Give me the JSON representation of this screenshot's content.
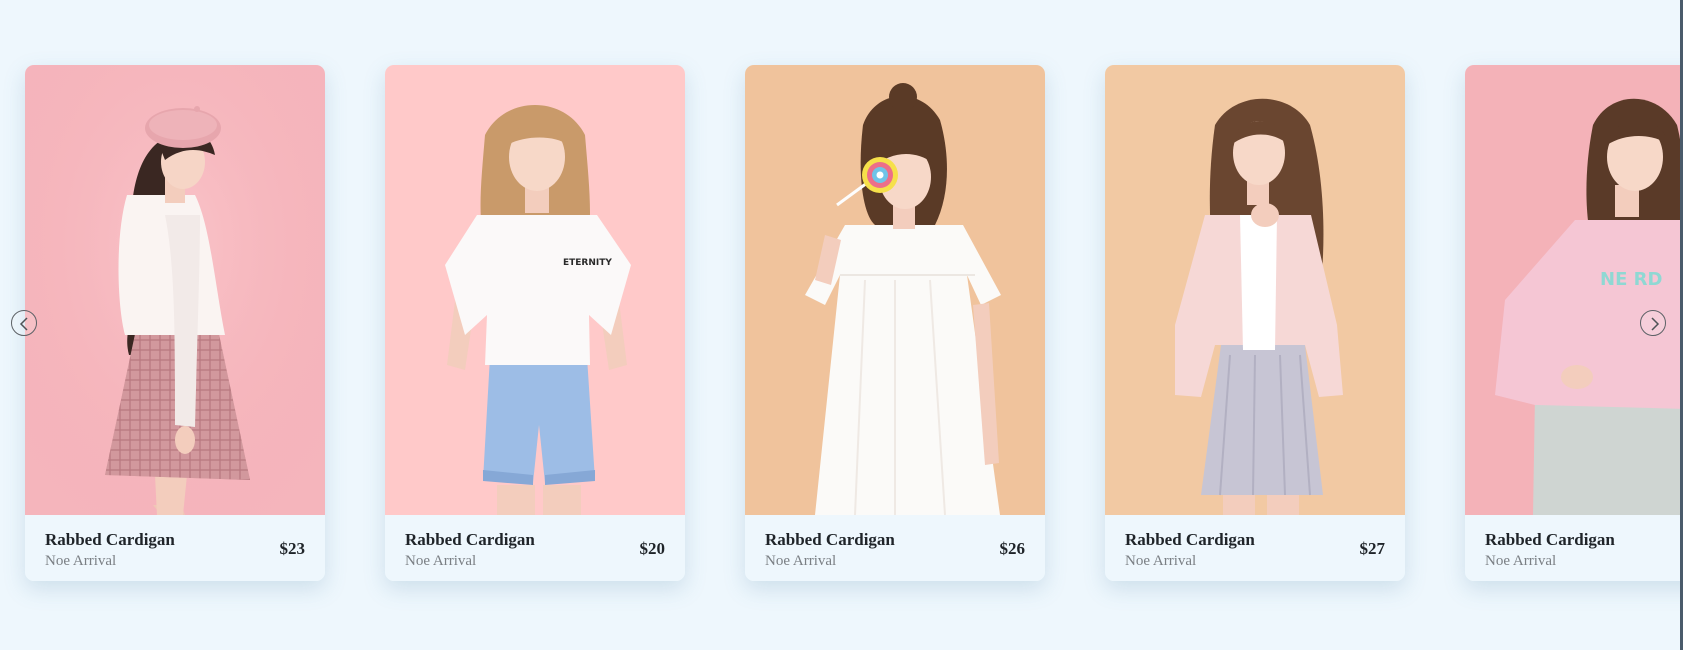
{
  "carousel": {
    "items": [
      {
        "title": "Rabbed Cardigan",
        "subtitle": "Noe Arrival",
        "price": "$23",
        "image_bg": "#f5b5bc",
        "image": "model-beret-plaid-skirt"
      },
      {
        "title": "Rabbed Cardigan",
        "subtitle": "Noe Arrival",
        "price": "$20",
        "image_bg": "#ffc9c9",
        "image": "model-white-tee-denim-shorts"
      },
      {
        "title": "Rabbed Cardigan",
        "subtitle": "Noe Arrival",
        "price": "$26",
        "image_bg": "#f0c39c",
        "image": "model-white-dress-lollipop"
      },
      {
        "title": "Rabbed Cardigan",
        "subtitle": "Noe Arrival",
        "price": "$27",
        "image_bg": "#f2c9a3",
        "image": "model-pink-cardigan-skirt"
      },
      {
        "title": "Rabbed Cardigan",
        "subtitle": "Noe Arrival",
        "price": "",
        "image_bg": "#f4b2b8",
        "image": "model-pink-sweatshirt"
      }
    ],
    "tee_print": "ETERNITY",
    "sweatshirt_print": "NE RD",
    "prev_icon": "chevron-left-icon",
    "next_icon": "chevron-right-icon",
    "colors": {
      "page_bg": "#eef7fd",
      "text_dark": "#1f2429",
      "text_muted": "#7a7f84"
    }
  }
}
